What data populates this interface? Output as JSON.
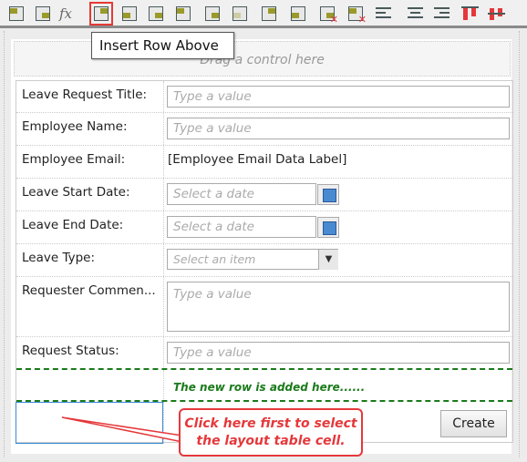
{
  "toolbar": {
    "icons": [
      "rule-lightning-icon",
      "form-eraser-icon",
      "formula-fx-icon",
      "insert-row-above-icon",
      "insert-row-below-icon",
      "insert-column-left-icon",
      "insert-column-right-icon",
      "merge-right-icon",
      "merge-down-icon",
      "layout-table-icon",
      "clear-cell-icon",
      "delete-column-icon",
      "delete-row-icon",
      "align-left-icon",
      "align-center-icon",
      "align-right-icon",
      "align-top-icon",
      "align-middle-icon"
    ],
    "selected": "insert-row-above-icon",
    "tooltip": "Insert Row Above"
  },
  "drag_zone": "Drag a control here",
  "form": {
    "rows": [
      {
        "label": "Leave Request Title:",
        "type": "text",
        "placeholder": "Type a value"
      },
      {
        "label": "Employee Name:",
        "type": "text",
        "placeholder": "Type a value"
      },
      {
        "label": "Employee Email:",
        "type": "label",
        "value": "[Employee Email Data Label]"
      },
      {
        "label": "Leave Start Date:",
        "type": "date",
        "placeholder": "Select a date"
      },
      {
        "label": "Leave End Date:",
        "type": "date",
        "placeholder": "Select a date"
      },
      {
        "label": "Leave Type:",
        "type": "dropdown",
        "placeholder": "Select an item"
      },
      {
        "label": "Requester Commen...",
        "type": "textarea",
        "placeholder": "Type a value"
      },
      {
        "label": "Request Status:",
        "type": "text",
        "placeholder": "Type a value"
      }
    ],
    "new_row_text": "The new row is added here......",
    "create_label": "Create"
  },
  "callout": {
    "line1": "Click here first to select",
    "line2": "the layout table cell."
  },
  "colors": {
    "accent_red": "#e5383b",
    "new_row_green": "#1a7a1a",
    "selected_cell": "#3a88d8"
  }
}
